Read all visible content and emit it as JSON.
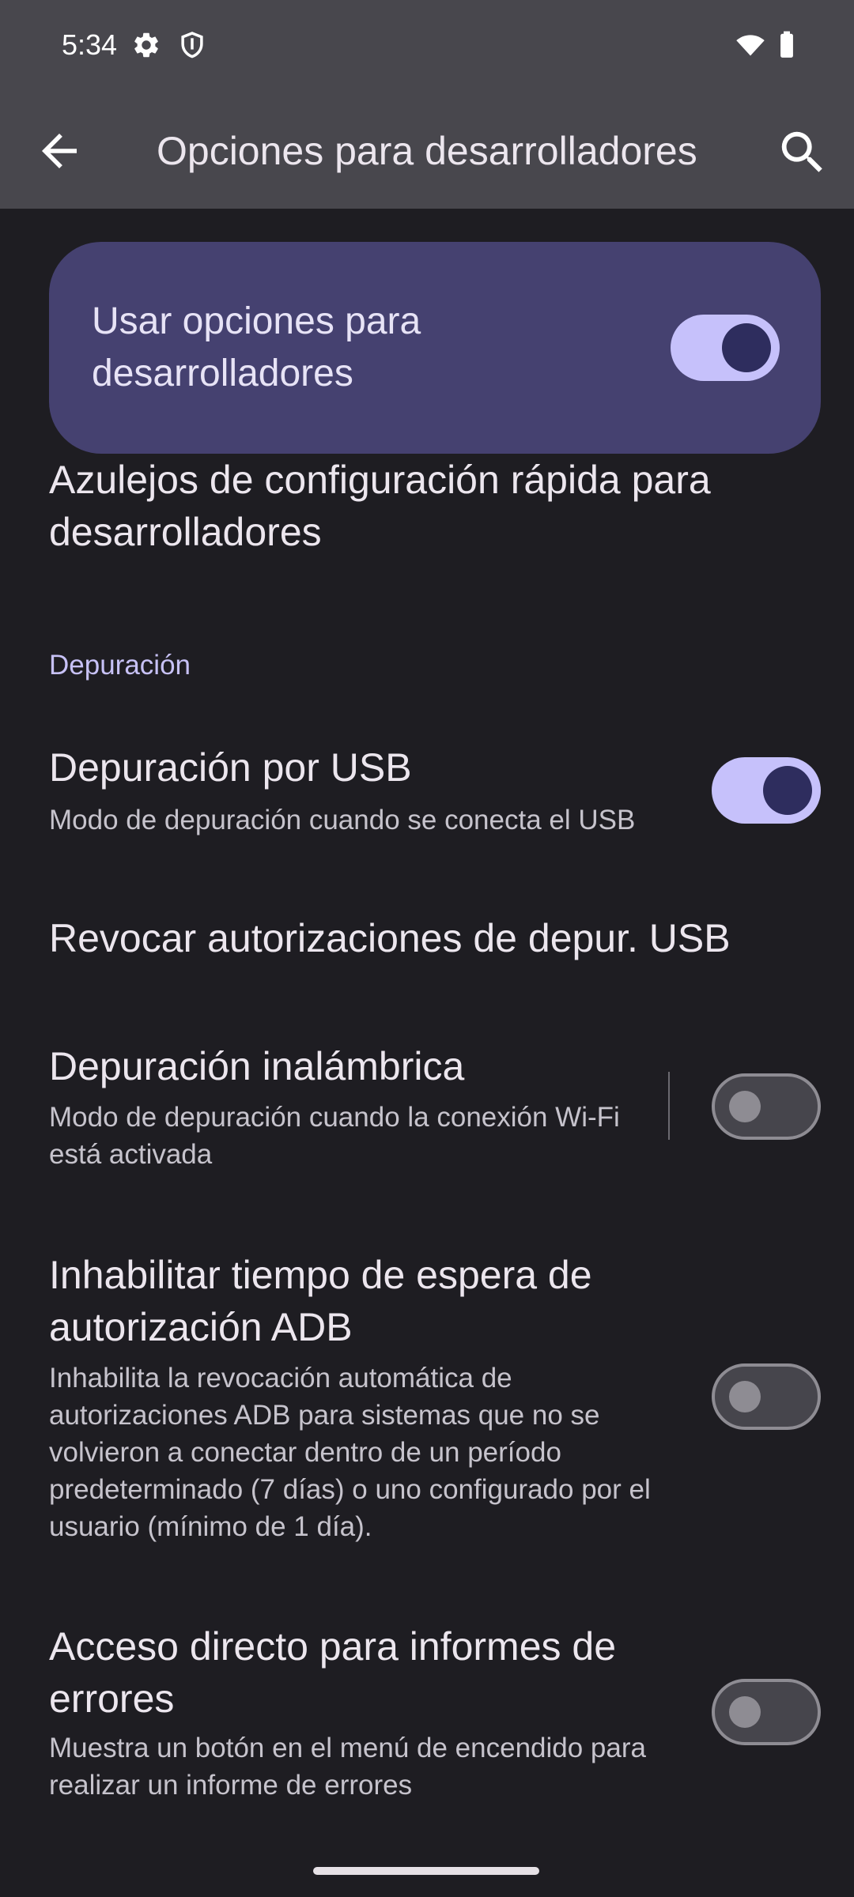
{
  "status_bar": {
    "time": "5:34"
  },
  "app_bar": {
    "title": "Opciones para desarrolladores"
  },
  "main_switch": {
    "label": "Usar opciones para desarrolladores",
    "checked": true
  },
  "preferences": [
    {
      "title": "Azulejos de configuración rápida para desarrolladores"
    },
    {
      "section": "Depuración"
    },
    {
      "title": "Depuración por USB",
      "summary": "Modo de depuración cuando se conecta el USB",
      "checked": true
    },
    {
      "title": "Revocar autorizaciones de depur. USB"
    },
    {
      "title": "Depuración inalámbrica",
      "summary": "Modo de depuración cuando la conexión Wi-Fi está activada",
      "checked": false
    },
    {
      "title": "Inhabilitar tiempo de espera de autorización ADB",
      "summary": "Inhabilita la revocación automática de autorizaciones ADB para sistemas que no se volvieron a conectar dentro de un período predeterminado (7 días) o uno configurado por el usuario (mínimo de 1 día).",
      "checked": false
    },
    {
      "title": "Acceso directo para informes de errores",
      "summary": "Muestra un botón en el menú de encendido para realizar un informe de errores",
      "checked": false
    }
  ],
  "icons": [
    "settings-gear-icon",
    "shield-icon",
    "wifi-icon",
    "battery-icon",
    "back-arrow-icon",
    "search-icon"
  ],
  "colors": {
    "accent": "#c6c1fb",
    "card": "#454170",
    "background": "#1e1d22",
    "app_bar": "#48474d"
  }
}
